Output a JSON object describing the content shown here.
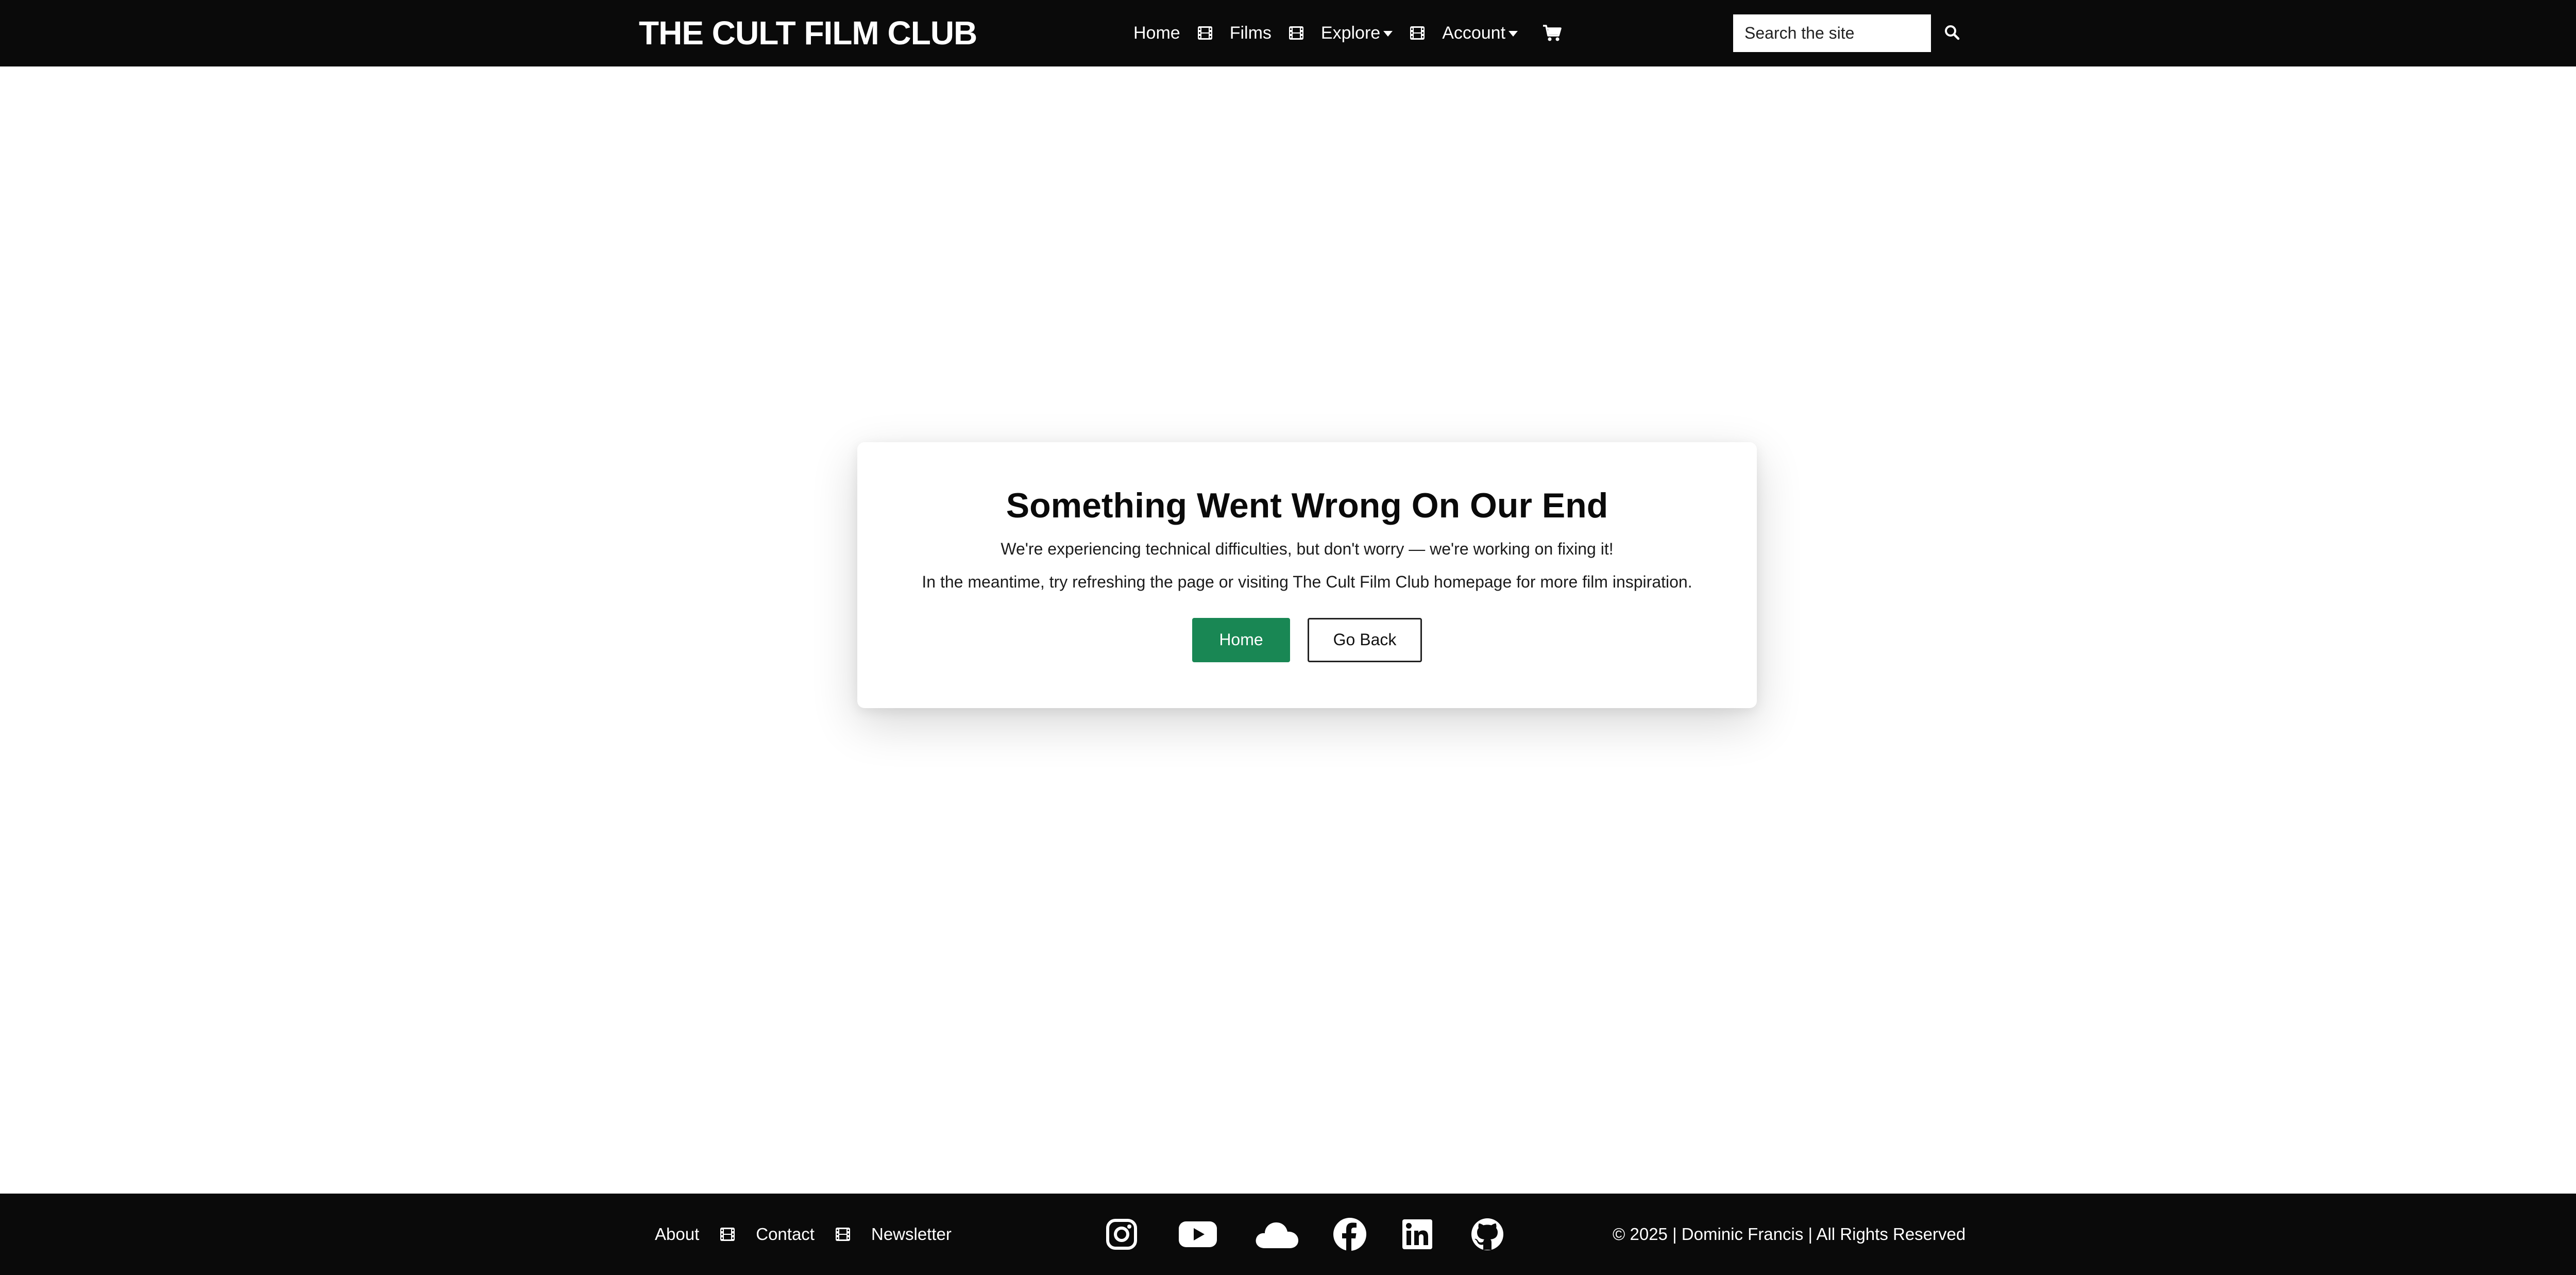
{
  "navbar": {
    "brand": "THE CULT FILM CLUB",
    "links": [
      {
        "label": "Home"
      },
      {
        "label": "Films"
      },
      {
        "label": "Explore"
      },
      {
        "label": "Account"
      }
    ],
    "separator_icon": "film-icon",
    "cart_icon": "cart-icon",
    "search": {
      "placeholder": "Search the site",
      "button_icon": "search-icon"
    }
  },
  "error_card": {
    "title": "Something Went Wrong On Our End",
    "message_1": "We're experiencing technical difficulties, but don't worry — we're working on fixing it!",
    "message_2": "In the meantime, try refreshing the page or visiting The Cult Film Club homepage for more film inspiration.",
    "home_button": "Home",
    "back_button": "Go Back"
  },
  "footer": {
    "links": [
      {
        "label": "About"
      },
      {
        "label": "Contact"
      },
      {
        "label": "Newsletter"
      }
    ],
    "social_icons": [
      "instagram-icon",
      "youtube-icon",
      "cloud-icon",
      "facebook-icon",
      "linkedin-icon",
      "github-icon"
    ],
    "copyright": "© 2025 | Dominic Francis | All Rights Reserved"
  },
  "colors": {
    "nav_background": "#0a0a0a",
    "primary_button": "#198754",
    "page_background": "#ffffff"
  }
}
